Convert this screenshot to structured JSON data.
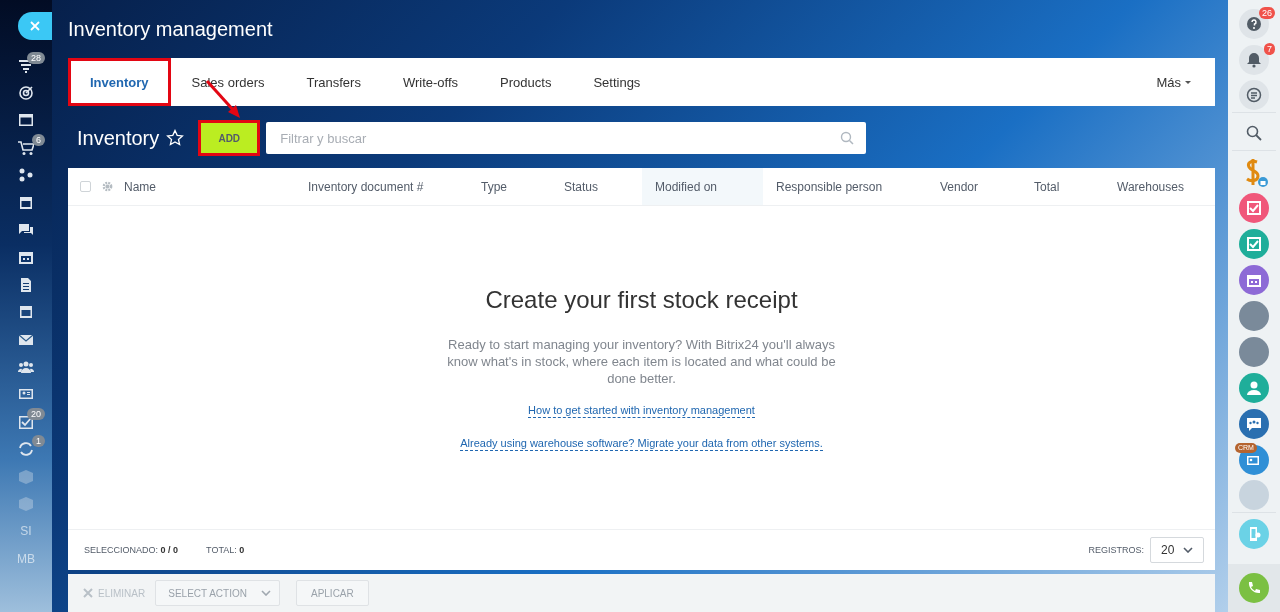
{
  "left_sidebar": {
    "items": [
      {
        "kind": "close"
      },
      {
        "kind": "funnel",
        "badge": "28"
      },
      {
        "kind": "target"
      },
      {
        "kind": "window"
      },
      {
        "kind": "cart",
        "badge": "6"
      },
      {
        "kind": "flow"
      },
      {
        "kind": "panel"
      },
      {
        "kind": "chat"
      },
      {
        "kind": "calendar"
      },
      {
        "kind": "document"
      },
      {
        "kind": "drawer"
      },
      {
        "kind": "mail"
      },
      {
        "kind": "team"
      },
      {
        "kind": "contact"
      },
      {
        "kind": "tasks",
        "badge": "20"
      },
      {
        "kind": "sync",
        "badge": "1"
      },
      {
        "kind": "box"
      },
      {
        "kind": "box"
      },
      {
        "kind": "text",
        "label": "SI"
      },
      {
        "kind": "text",
        "label": "MB"
      }
    ]
  },
  "title": "Inventory management",
  "tabs": [
    {
      "label": "Inventory",
      "selected": true,
      "highlighted": true
    },
    {
      "label": "Sales orders",
      "selected": false,
      "highlighted": false
    },
    {
      "label": "Transfers",
      "selected": false,
      "highlighted": false
    },
    {
      "label": "Write-offs",
      "selected": false,
      "highlighted": false
    },
    {
      "label": "Products",
      "selected": false,
      "highlighted": false
    },
    {
      "label": "Settings",
      "selected": false,
      "highlighted": false
    }
  ],
  "more_menu": "Más",
  "toolbar": {
    "heading": "Inventory",
    "add_button": {
      "label": "ADD",
      "highlighted": true
    },
    "search": {
      "placeholder": "Filtrar y buscar"
    }
  },
  "table": {
    "select_all_checked": false,
    "columns": [
      {
        "label": "Name",
        "sorted": false
      },
      {
        "label": "Inventory document #",
        "sorted": false
      },
      {
        "label": "Type",
        "sorted": false
      },
      {
        "label": "Status",
        "sorted": false
      },
      {
        "label": "Modified on",
        "sorted": true
      },
      {
        "label": "Responsible person",
        "sorted": false
      },
      {
        "label": "Vendor",
        "sorted": false
      },
      {
        "label": "Total",
        "sorted": false
      },
      {
        "label": "Warehouses",
        "sorted": false
      }
    ],
    "empty_state": {
      "title": "Create your first stock receipt",
      "text": "Ready to start managing your inventory? With Bitrix24 you'll always know what's in stock, where each item is located and what could be done better.",
      "links": [
        "How to get started with inventory management",
        "Already using warehouse software? Migrate your data from other systems."
      ]
    },
    "footer": {
      "selected_label": "SELECCIONADO:",
      "selected_value": "0 / 0",
      "total_label": "TOTAL:",
      "total_value": "0",
      "page_size_label": "REGISTROS:",
      "page_size": "20"
    }
  },
  "action_bar": {
    "delete": "ELIMINAR",
    "select_action": "SELECT ACTION",
    "apply": "APLICAR"
  },
  "right_panel": {
    "items": [
      {
        "kind": "help",
        "badge": "26"
      },
      {
        "kind": "bell",
        "badge": "7"
      },
      {
        "kind": "messages"
      },
      {
        "kind": "search"
      },
      {
        "kind": "dollar"
      },
      {
        "kind": "task"
      },
      {
        "kind": "checklist"
      },
      {
        "kind": "calendar"
      },
      {
        "kind": "avatar"
      },
      {
        "kind": "avatar"
      },
      {
        "kind": "person"
      },
      {
        "kind": "group"
      },
      {
        "kind": "crm",
        "label": "CRM"
      },
      {
        "kind": "partial"
      },
      {
        "kind": "device"
      },
      {
        "kind": "call"
      }
    ]
  }
}
